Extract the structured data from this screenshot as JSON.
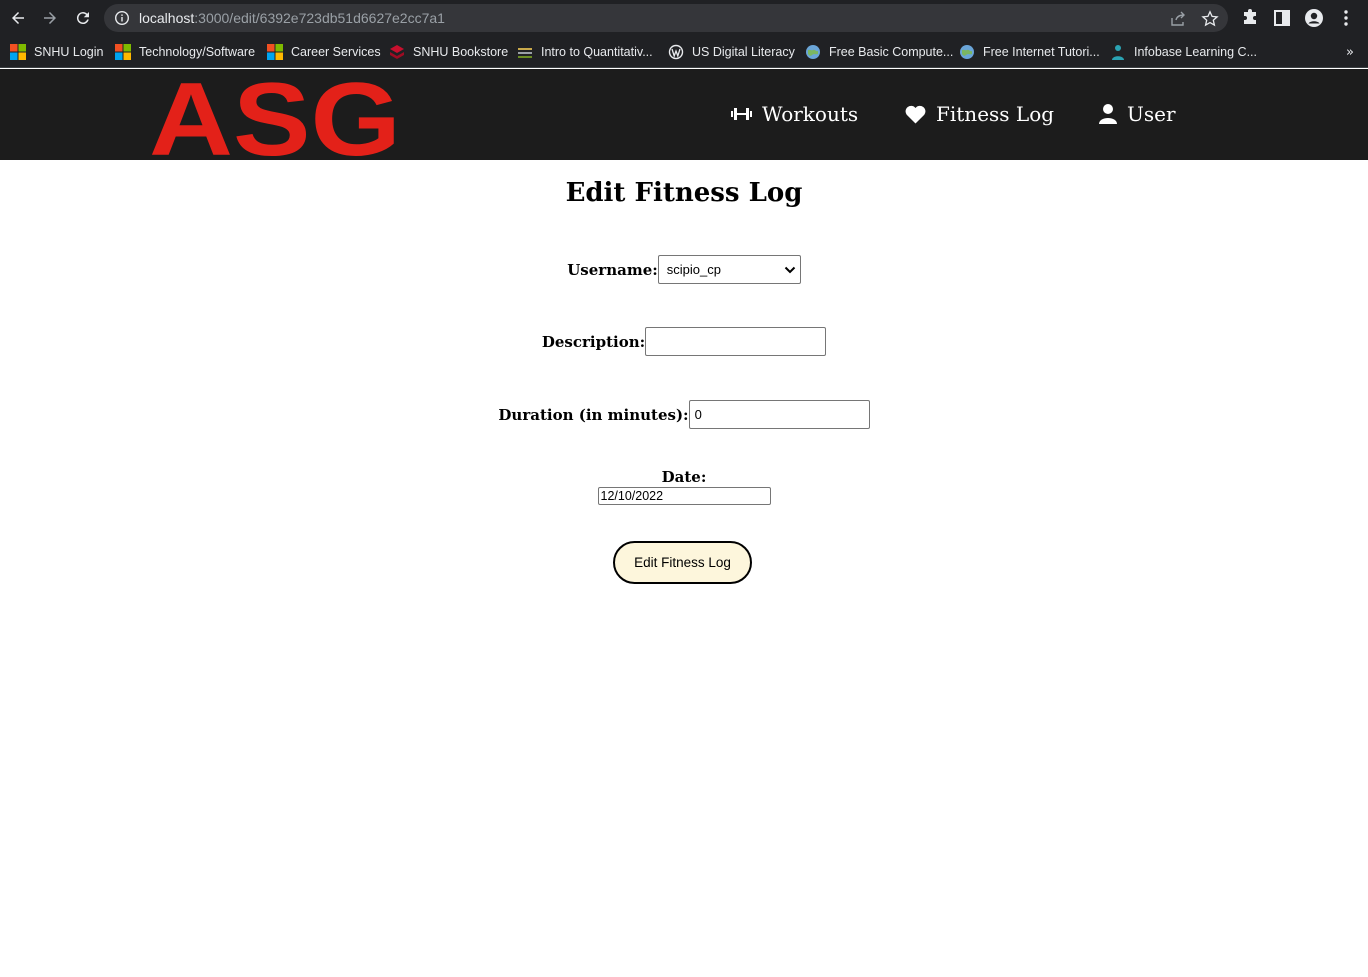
{
  "browser": {
    "url_host": "localhost",
    "url_path": ":3000/edit/6392e723db51d6627e2cc7a1",
    "bookmarks": [
      {
        "label": "SNHU Login",
        "icon": "microsoft-icon"
      },
      {
        "label": "Technology/Software",
        "icon": "microsoft-icon"
      },
      {
        "label": "Career Services",
        "icon": "microsoft-icon"
      },
      {
        "label": "SNHU Bookstore",
        "icon": "book-icon"
      },
      {
        "label": "Intro to Quantitativ...",
        "icon": "stack-icon"
      },
      {
        "label": "US Digital Literacy",
        "icon": "wordpress-icon"
      },
      {
        "label": "Free Basic Compute...",
        "icon": "globe-icon"
      },
      {
        "label": "Free Internet Tutori...",
        "icon": "globe-icon"
      },
      {
        "label": "Infobase Learning C...",
        "icon": "person-icon"
      }
    ],
    "more_label": "»"
  },
  "site": {
    "logo_text": "ASG",
    "nav": [
      {
        "label": "Workouts",
        "icon": "dumbbell-icon"
      },
      {
        "label": "Fitness Log",
        "icon": "heart-icon"
      },
      {
        "label": "User",
        "icon": "user-icon"
      }
    ]
  },
  "form": {
    "title": "Edit Fitness Log",
    "username_label": "Username:",
    "username_value": "scipio_cp",
    "description_label": "Description:",
    "description_value": "",
    "duration_label": "Duration (in minutes):",
    "duration_value": "0",
    "date_label": "Date:",
    "date_value": "12/10/2022",
    "submit_label": "Edit Fitness Log"
  },
  "colors": {
    "logo_red": "#e32119",
    "header_bg": "#1c1c1c",
    "button_bg": "#fdf6dc"
  }
}
